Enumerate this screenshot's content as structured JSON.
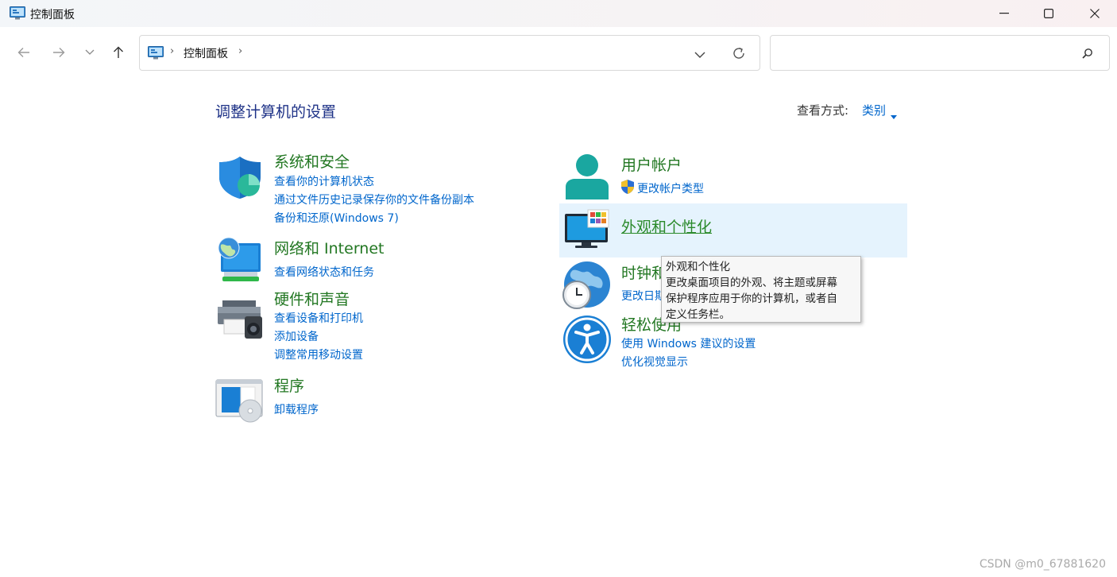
{
  "window": {
    "title": "控制面板"
  },
  "nav": {
    "breadcrumb": "控制面板",
    "search_placeholder": ""
  },
  "header": {
    "title": "调整计算机的设置",
    "view_by_label": "查看方式:",
    "view_by_value": "类别"
  },
  "categories": {
    "system": {
      "title": "系统和安全",
      "links": [
        "查看你的计算机状态",
        "通过文件历史记录保存你的文件备份副本",
        "备份和还原(Windows 7)"
      ]
    },
    "network": {
      "title": "网络和 Internet",
      "links": [
        "查看网络状态和任务"
      ]
    },
    "hardware": {
      "title": "硬件和声音",
      "links": [
        "查看设备和打印机",
        "添加设备",
        "调整常用移动设置"
      ]
    },
    "programs": {
      "title": "程序",
      "links": [
        "卸载程序"
      ]
    },
    "users": {
      "title": "用户帐户",
      "links": [
        "更改帐户类型"
      ]
    },
    "appearance": {
      "title": "外观和个性化",
      "links": []
    },
    "clock": {
      "title": "时钟和",
      "links": [
        "更改日期"
      ]
    },
    "ease": {
      "title": "轻松使用",
      "links": [
        "使用 Windows 建议的设置",
        "优化视觉显示"
      ]
    }
  },
  "tooltip": {
    "title": "外观和个性化",
    "body": [
      "更改桌面项目的外观、将主题或屏幕",
      "保护程序应用于你的计算机，或者自",
      "定义任务栏。"
    ]
  },
  "watermark": "CSDN @m0_67881620",
  "colors": {
    "link": "#0066cc",
    "category": "#227722",
    "title": "#1e3287",
    "hover": "#e5f3fd"
  }
}
